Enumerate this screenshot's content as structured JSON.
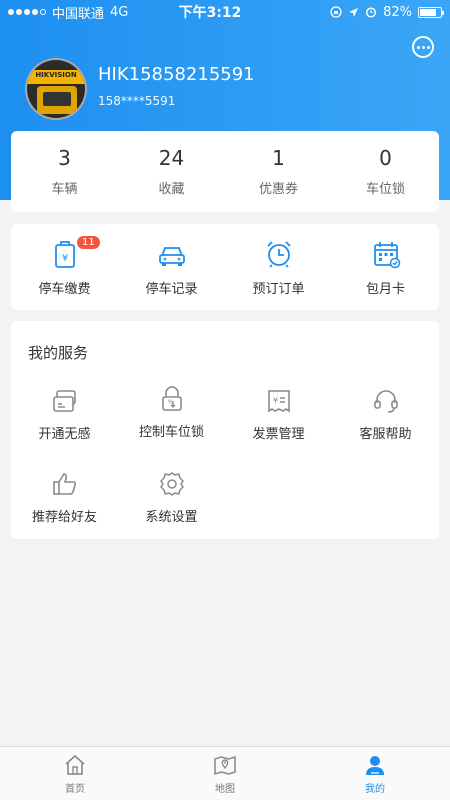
{
  "status_bar": {
    "carrier": "中国联通",
    "network": "4G",
    "time": "下午3:12",
    "battery": "82%",
    "battery_level": 0.82
  },
  "profile": {
    "avatar_brand": "HIKVISION",
    "username": "HIK15858215591",
    "phone": "158****5591"
  },
  "stats": [
    {
      "value": "3",
      "label": "车辆"
    },
    {
      "value": "24",
      "label": "收藏"
    },
    {
      "value": "1",
      "label": "优惠券"
    },
    {
      "value": "0",
      "label": "车位锁"
    }
  ],
  "quick_actions": [
    {
      "label": "停车缴费",
      "icon": "parking-payment-icon",
      "badge": "11"
    },
    {
      "label": "停车记录",
      "icon": "car-icon"
    },
    {
      "label": "预订订单",
      "icon": "alarm-clock-icon"
    },
    {
      "label": "包月卡",
      "icon": "calendar-icon"
    }
  ],
  "services": {
    "title": "我的服务",
    "items": [
      {
        "label": "开通无感",
        "icon": "card-icon"
      },
      {
        "label": "控制车位锁",
        "icon": "lock-icon"
      },
      {
        "label": "发票管理",
        "icon": "invoice-icon"
      },
      {
        "label": "客服帮助",
        "icon": "headset-icon"
      },
      {
        "label": "推荐给好友",
        "icon": "thumbs-up-icon"
      },
      {
        "label": "系统设置",
        "icon": "gear-icon"
      }
    ]
  },
  "tabbar": [
    {
      "label": "首页",
      "icon": "home-icon"
    },
    {
      "label": "地图",
      "icon": "map-icon"
    },
    {
      "label": "我的",
      "icon": "user-icon",
      "active": true
    }
  ],
  "colors": {
    "primary": "#1d8ff0",
    "badge": "#f5533d",
    "icon_gray": "#8a8a8a"
  }
}
